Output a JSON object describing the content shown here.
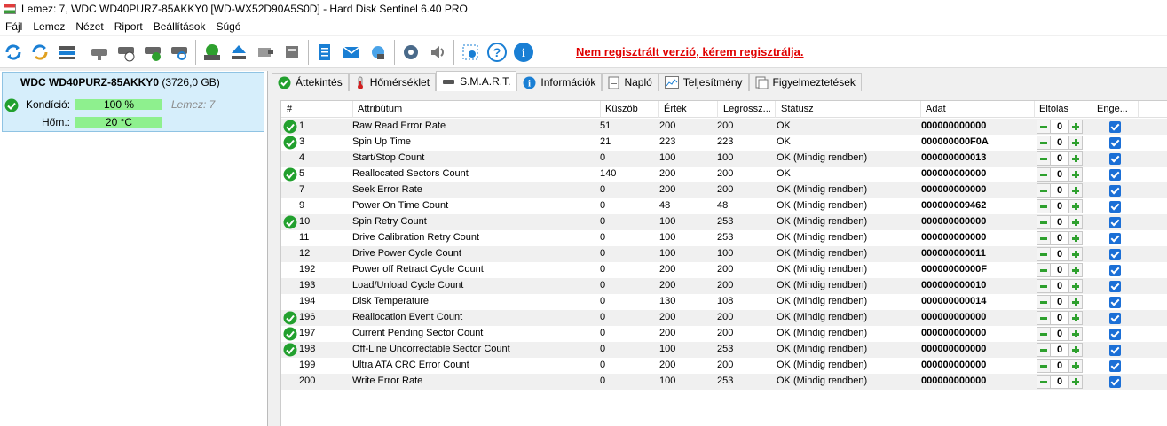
{
  "window": {
    "title": "Lemez: 7, WDC WD40PURZ-85AKKY0 [WD-WX52D90A5S0D]  -  Hard Disk Sentinel 6.40 PRO"
  },
  "menu": [
    "Fájl",
    "Lemez",
    "Nézet",
    "Riport",
    "Beállítások",
    "Súgó"
  ],
  "toolbar": {
    "unregistered_notice": "Nem regisztrált verzió, kérem regisztrálja."
  },
  "disk": {
    "name": "WDC WD40PURZ-85AKKY0",
    "size": "(3726,0 GB)",
    "condition_label": "Kondíció:",
    "condition_value": "100 %",
    "condition_percent": 100,
    "temp_label": "Hőm.:",
    "temp_value": "20 °C",
    "disk_ref": "Lemez: 7"
  },
  "tabs": [
    "Áttekintés",
    "Hőmérséklet",
    "S.M.A.R.T.",
    "Információk",
    "Napló",
    "Teljesítmény",
    "Figyelmeztetések"
  ],
  "smart": {
    "columns": [
      "#",
      "Attribútum",
      "Küszöb",
      "Érték",
      "Legrossz...",
      "Státusz",
      "Adat",
      "Eltolás",
      "Enge..."
    ],
    "rows": [
      {
        "id": "1",
        "name": "Raw Read Error Rate",
        "threshold": "51",
        "value": "200",
        "worst": "200",
        "status": "OK",
        "data": "000000000000",
        "offset": "0",
        "ok": true
      },
      {
        "id": "3",
        "name": "Spin Up Time",
        "threshold": "21",
        "value": "223",
        "worst": "223",
        "status": "OK",
        "data": "000000000F0A",
        "offset": "0",
        "ok": true
      },
      {
        "id": "4",
        "name": "Start/Stop Count",
        "threshold": "0",
        "value": "100",
        "worst": "100",
        "status": "OK (Mindig rendben)",
        "data": "000000000013",
        "offset": "0",
        "ok": false
      },
      {
        "id": "5",
        "name": "Reallocated Sectors Count",
        "threshold": "140",
        "value": "200",
        "worst": "200",
        "status": "OK",
        "data": "000000000000",
        "offset": "0",
        "ok": true
      },
      {
        "id": "7",
        "name": "Seek Error Rate",
        "threshold": "0",
        "value": "200",
        "worst": "200",
        "status": "OK (Mindig rendben)",
        "data": "000000000000",
        "offset": "0",
        "ok": false
      },
      {
        "id": "9",
        "name": "Power On Time Count",
        "threshold": "0",
        "value": "48",
        "worst": "48",
        "status": "OK (Mindig rendben)",
        "data": "000000009462",
        "offset": "0",
        "ok": false
      },
      {
        "id": "10",
        "name": "Spin Retry Count",
        "threshold": "0",
        "value": "100",
        "worst": "253",
        "status": "OK (Mindig rendben)",
        "data": "000000000000",
        "offset": "0",
        "ok": true
      },
      {
        "id": "11",
        "name": "Drive Calibration Retry Count",
        "threshold": "0",
        "value": "100",
        "worst": "253",
        "status": "OK (Mindig rendben)",
        "data": "000000000000",
        "offset": "0",
        "ok": false
      },
      {
        "id": "12",
        "name": "Drive Power Cycle Count",
        "threshold": "0",
        "value": "100",
        "worst": "100",
        "status": "OK (Mindig rendben)",
        "data": "000000000011",
        "offset": "0",
        "ok": false
      },
      {
        "id": "192",
        "name": "Power off Retract Cycle Count",
        "threshold": "0",
        "value": "200",
        "worst": "200",
        "status": "OK (Mindig rendben)",
        "data": "00000000000F",
        "offset": "0",
        "ok": false
      },
      {
        "id": "193",
        "name": "Load/Unload Cycle Count",
        "threshold": "0",
        "value": "200",
        "worst": "200",
        "status": "OK (Mindig rendben)",
        "data": "000000000010",
        "offset": "0",
        "ok": false
      },
      {
        "id": "194",
        "name": "Disk Temperature",
        "threshold": "0",
        "value": "130",
        "worst": "108",
        "status": "OK (Mindig rendben)",
        "data": "000000000014",
        "offset": "0",
        "ok": false
      },
      {
        "id": "196",
        "name": "Reallocation Event Count",
        "threshold": "0",
        "value": "200",
        "worst": "200",
        "status": "OK (Mindig rendben)",
        "data": "000000000000",
        "offset": "0",
        "ok": true
      },
      {
        "id": "197",
        "name": "Current Pending Sector Count",
        "threshold": "0",
        "value": "200",
        "worst": "200",
        "status": "OK (Mindig rendben)",
        "data": "000000000000",
        "offset": "0",
        "ok": true
      },
      {
        "id": "198",
        "name": "Off-Line Uncorrectable Sector Count",
        "threshold": "0",
        "value": "100",
        "worst": "253",
        "status": "OK (Mindig rendben)",
        "data": "000000000000",
        "offset": "0",
        "ok": true
      },
      {
        "id": "199",
        "name": "Ultra ATA CRC Error Count",
        "threshold": "0",
        "value": "200",
        "worst": "200",
        "status": "OK (Mindig rendben)",
        "data": "000000000000",
        "offset": "0",
        "ok": false
      },
      {
        "id": "200",
        "name": "Write Error Rate",
        "threshold": "0",
        "value": "100",
        "worst": "253",
        "status": "OK (Mindig rendben)",
        "data": "000000000000",
        "offset": "0",
        "ok": false
      }
    ]
  }
}
